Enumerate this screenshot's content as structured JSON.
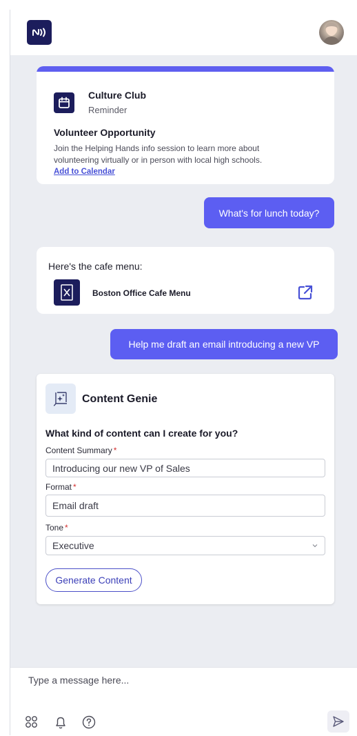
{
  "reminder": {
    "club": "Culture Club",
    "type": "Reminder",
    "heading": "Volunteer Opportunity",
    "body": "Join the Helping Hands info session to learn more about volunteering virtually or in person with local high schools.",
    "link": "Add to Calendar"
  },
  "messages": {
    "user_1": "What's for lunch today?",
    "bot_1_intro": "Here's the cafe menu:",
    "attachment_name": "Boston Office Cafe Menu",
    "user_2": "Help me draft an email introducing a new VP"
  },
  "genie": {
    "title": "Content Genie",
    "question": "What kind of content can I create for you?",
    "summary_label": "Content Summary",
    "summary_value": "Introducing our new VP of Sales",
    "format_label": "Format",
    "format_value": "Email draft",
    "tone_label": "Tone",
    "tone_value": "Executive",
    "required_mark": "*",
    "generate_label": "Generate Content"
  },
  "composer": {
    "placeholder": "Type a message here..."
  },
  "icons": {
    "logo": "nfc-logo-icon",
    "calendar": "calendar-icon",
    "document": "document-icon",
    "external": "external-link-icon",
    "sparkle": "sparkle-chart-icon",
    "apps": "apps-grid-icon",
    "bell": "bell-icon",
    "help": "help-circle-icon",
    "send": "send-icon"
  },
  "colors": {
    "accent": "#5c5ef2",
    "navy": "#1c1d5c",
    "required": "#d32f2f"
  }
}
